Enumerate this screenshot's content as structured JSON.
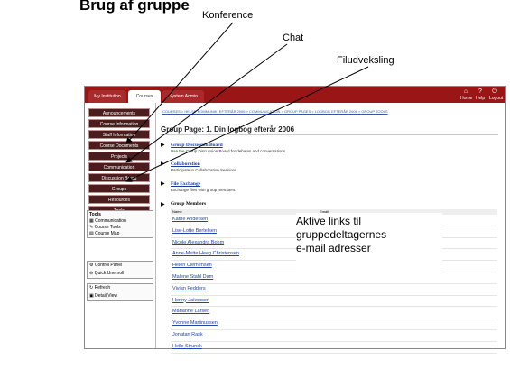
{
  "slide": {
    "title": "Brug af gruppe",
    "callouts": {
      "konference": "Konference",
      "chat": "Chat",
      "filudveksling": "Filudveksling"
    },
    "note_lines": [
      "Aktive links til",
      "gruppedeltagernes",
      "e-mail adresser"
    ]
  },
  "topbar": {
    "tabs": [
      "My Institution",
      "Courses",
      "System Admin"
    ],
    "icons": [
      {
        "name": "home-icon",
        "label": "Home"
      },
      {
        "name": "help-icon",
        "label": "Help"
      },
      {
        "name": "logout-icon",
        "label": "Logout"
      }
    ]
  },
  "sidebar": {
    "menu": [
      "Announcements",
      "Course Information",
      "Staff Information",
      "Course Documents",
      "Projects",
      "Communication",
      "Discussion Board",
      "Groups",
      "Resources",
      "Tools"
    ],
    "tools_title": "Tools",
    "tools_items": [
      "Communication",
      "Course Tools",
      "Course Map"
    ],
    "panel_items": [
      "Control Panel",
      "Quick Unenroll"
    ],
    "view_items": [
      "Refresh",
      "Detail View"
    ]
  },
  "main": {
    "breadcrumb": "COURSES > HELSE KOMMUNIK. EFTERÅR 2006 > COMMUNICATION > GROUP PAGES > LOGBOG EFTERÅR 2006 > GROUP TOOLS",
    "page_title": "Group Page: 1. Din logbog efterår 2006",
    "sections": [
      {
        "link": "Group Discussion Board",
        "desc": "Use the Group Discussion Board for debates and conversations."
      },
      {
        "link": "Collaboration",
        "desc": "Participate in Collaboration Sessions."
      },
      {
        "link": "File Exchange",
        "desc": "Exchange files with group members."
      }
    ],
    "members_header": "Group Members",
    "col_name": "Name",
    "col_email": "Email",
    "members": [
      "Kathe Andersen",
      "Lise-Lotte Bertelsen",
      "Nicole Alexandra Bohm",
      "Anne-Mette Heeg Christensen",
      "Helen Clemensen",
      "Malene Stahl Dam",
      "Vivian Fedders",
      "Henny Jakobsen",
      "Marianne Larsen",
      "Yvonne Martinussen",
      "Jonatan Rask",
      "Helle Strunck"
    ]
  }
}
